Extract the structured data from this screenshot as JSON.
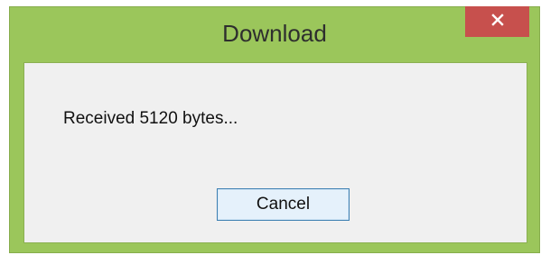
{
  "window": {
    "title": "Download"
  },
  "dialog": {
    "message": "Received 5120 bytes...",
    "cancel_label": "Cancel"
  },
  "icons": {
    "close": "close-icon"
  },
  "colors": {
    "titlebar": "#9bc65b",
    "close_button": "#c7504d",
    "client_background": "#f0f0f0",
    "button_border": "#3c7fb1",
    "button_fill": "#e5f1fb"
  }
}
